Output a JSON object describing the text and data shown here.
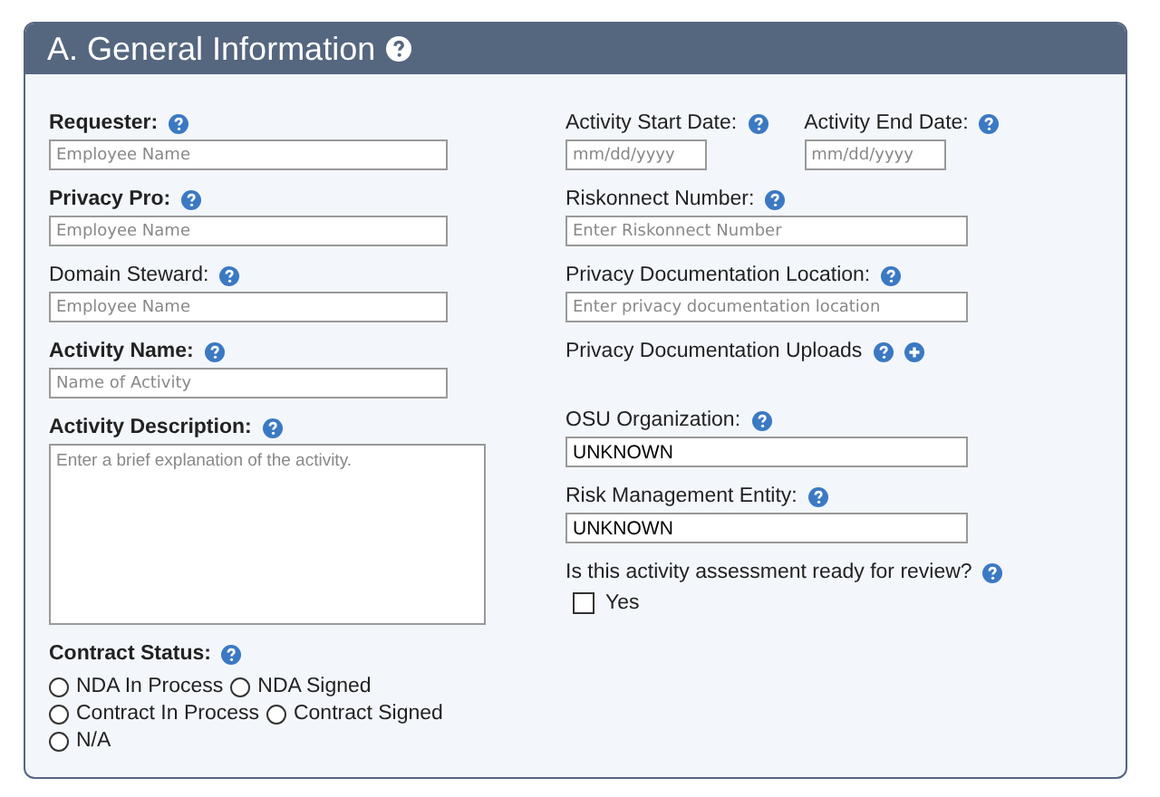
{
  "panel": {
    "title": "A. General Information"
  },
  "left_fields": [
    {
      "kind": "input",
      "label": "Requester:",
      "bold": true,
      "placeholder": "Employee Name"
    },
    {
      "kind": "input",
      "label": "Privacy Pro:",
      "bold": true,
      "placeholder": "Employee Name"
    },
    {
      "kind": "input",
      "label": "Domain Steward:",
      "bold": false,
      "placeholder": "Employee Name"
    },
    {
      "kind": "input",
      "label": "Activity Name:",
      "bold": true,
      "placeholder": "Name of Activity"
    },
    {
      "kind": "textarea",
      "label": "Activity Description:",
      "bold": true,
      "placeholder": "Enter a brief explanation of the activity."
    }
  ],
  "contract_status": {
    "label": "Contract Status:",
    "options": [
      {
        "label": "NDA In Process",
        "selected": false
      },
      {
        "label": "NDA Signed",
        "selected": false
      },
      {
        "label": "Contract In Process",
        "selected": false
      },
      {
        "label": "Contract Signed",
        "selected": false
      },
      {
        "label": "N/A",
        "selected": false
      }
    ]
  },
  "dates": [
    {
      "label": "Activity Start Date:",
      "placeholder": "mm/dd/yyyy"
    },
    {
      "label": "Activity End Date:",
      "placeholder": "mm/dd/yyyy"
    }
  ],
  "right_fields": [
    {
      "kind": "input",
      "label": "Riskonnect Number:",
      "placeholder": "Enter Riskonnect Number"
    },
    {
      "kind": "input",
      "label": "Privacy Documentation Location:",
      "placeholder": "Enter privacy documentation location"
    },
    {
      "kind": "upload",
      "label": "Privacy Documentation Uploads"
    },
    {
      "kind": "value",
      "label": "OSU Organization:",
      "value": "UNKNOWN"
    },
    {
      "kind": "value",
      "label": "Risk Management Entity:",
      "value": "UNKNOWN"
    }
  ],
  "review": {
    "question": "Is this activity assessment ready for review?",
    "option": "Yes",
    "checked": false
  }
}
